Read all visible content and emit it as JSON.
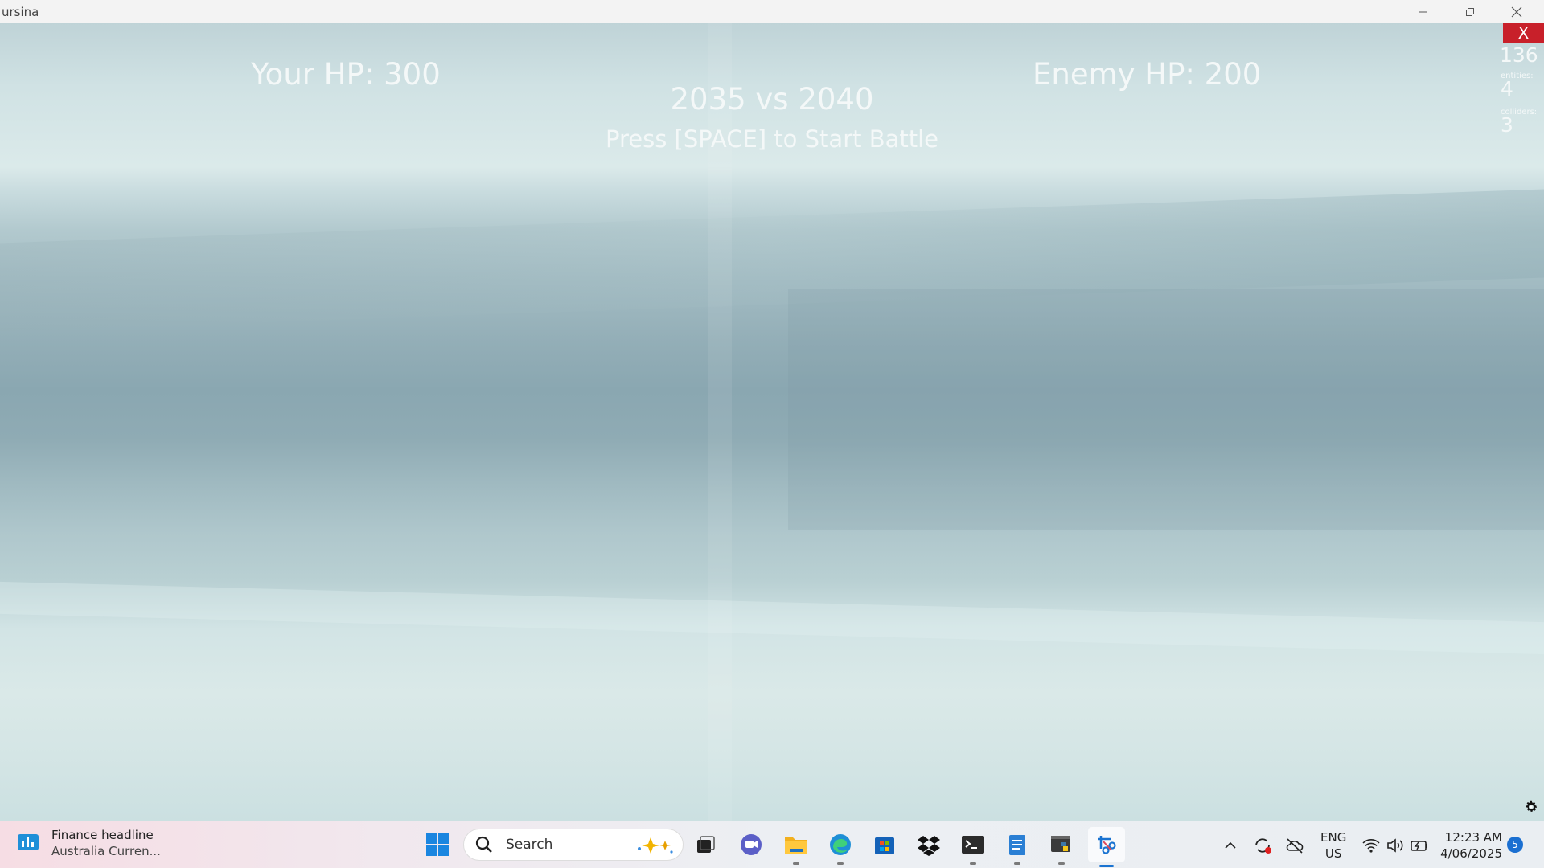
{
  "window": {
    "title": "ursina",
    "minimize_icon": "minimize-icon",
    "restore_icon": "restore-icon",
    "close_icon": "close-icon"
  },
  "game": {
    "your_hp": "Your HP: 300",
    "enemy_hp": "Enemy HP: 200",
    "versus": "2035 vs 2040",
    "prompt": "Press [SPACE] to Start Battle"
  },
  "debug": {
    "exit_label": "X",
    "fps": "136",
    "entities_label": "entities:",
    "entities_value": "4",
    "colliders_label": "colliders:",
    "colliders_value": "3",
    "settings_icon": "gear-icon"
  },
  "taskbar": {
    "widget_title": "Finance headline",
    "widget_subtitle": "Australia Curren...",
    "search_placeholder": "Search",
    "apps": [
      "start-icon",
      "task-view-icon",
      "chat-icon",
      "file-explorer-icon",
      "edge-icon",
      "store-icon",
      "dropbox-icon",
      "terminal-icon",
      "notepad-icon",
      "python-icon",
      "snipping-tool-icon"
    ],
    "language_line1": "ENG",
    "language_line2": "US",
    "time": "12:23 AM",
    "date": "4/06/2025",
    "notification_count": "5"
  },
  "colors": {
    "exit_button": "#c8202a",
    "hud_text": "#f4f8f8",
    "notification_badge": "#1a6fd1"
  }
}
